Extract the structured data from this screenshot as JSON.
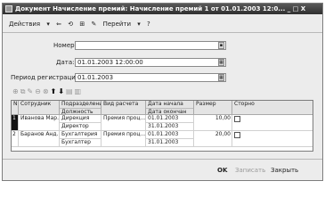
{
  "window": {
    "title": "Документ Начисление премий: Начисление премий 1 от 01.01.2003 12:0... _ □ X"
  },
  "toolbar": {
    "actions_label": "Действия",
    "goto_label": "Перейти",
    "help_label": "?"
  },
  "form": {
    "number_label": "Номер:",
    "number_value": "",
    "date_label": "Дата:",
    "date_value": "01.01.2003 12:00:00",
    "period_label": "Период регистрации:",
    "period_value": "01.01.2003"
  },
  "grid": {
    "headers": {
      "n": "N",
      "employee": "Сотрудник",
      "dept": "Подразделение",
      "position": "Должность",
      "calc_type": "Вид расчета",
      "date_start": "Дата начала",
      "date_end": "Дата окончан",
      "size": "Размер",
      "storno": "Сторно"
    },
    "rows": [
      {
        "n": "1",
        "employee": "Иванова Мар...",
        "dept": "Дирекция",
        "position": "Директор",
        "calc_type": "Премия проц...",
        "date_start": "01.01.2003",
        "date_end": "31.01.2003",
        "size": "10,00"
      },
      {
        "n": "2",
        "employee": "Баранов Анд...",
        "dept": "Бухгалтерия",
        "position": "Бухгалтер",
        "calc_type": "Премия проц...",
        "date_start": "01.01.2003",
        "date_end": "31.01.2003",
        "size": "20,00"
      }
    ]
  },
  "footer": {
    "ok_label": "OK",
    "save_label": "Записать",
    "close_label": "Закрыть"
  }
}
